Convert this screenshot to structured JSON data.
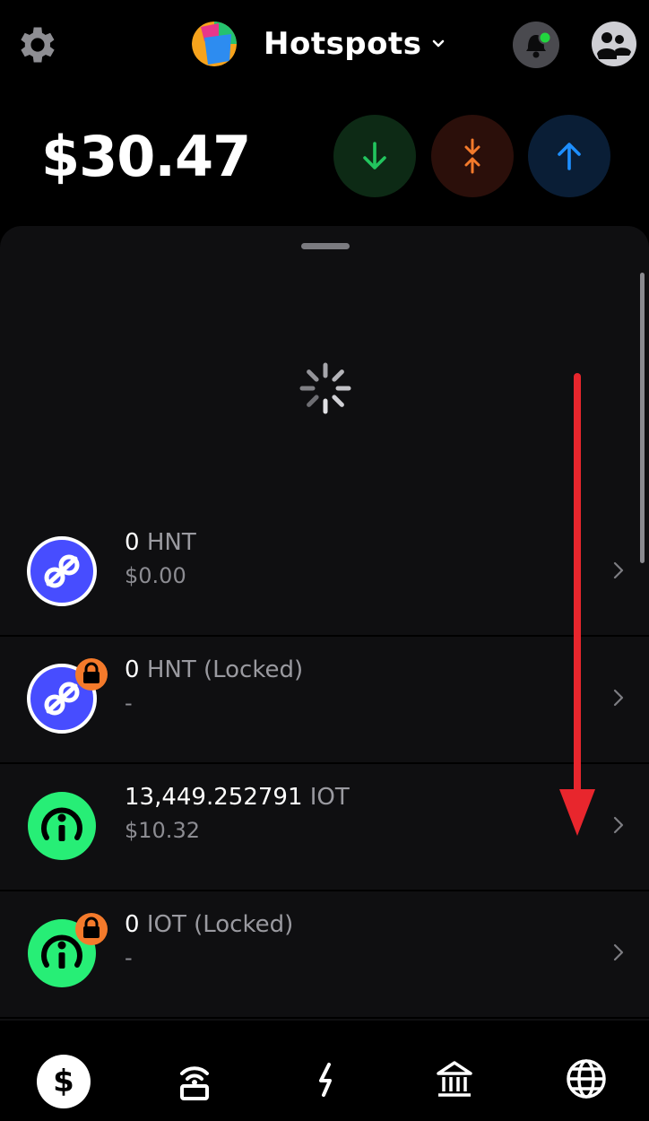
{
  "header": {
    "title": "Hotspots",
    "icons": [
      "gear-icon",
      "app-logo",
      "chevron-down-icon",
      "notification-bell-icon",
      "account-icon"
    ]
  },
  "balance": "$30.47",
  "actions": {
    "receive_icon": "arrow-down-icon",
    "swap_icon": "swap-icon",
    "send_icon": "arrow-up-icon",
    "colors": {
      "receive": "#22c55e",
      "swap": "#f47a2b",
      "send": "#1e8fff"
    }
  },
  "tokens": [
    {
      "amount": "0",
      "ticker": "HNT",
      "fiat": "$0.00",
      "icon": "helium-icon",
      "locked": false
    },
    {
      "amount": "0",
      "ticker": "HNT (Locked)",
      "fiat": "-",
      "icon": "helium-icon",
      "locked": true
    },
    {
      "amount": "13,449.252791",
      "ticker": "IOT",
      "fiat": "$10.32",
      "icon": "iot-icon",
      "locked": false
    },
    {
      "amount": "0",
      "ticker": "IOT (Locked)",
      "fiat": "-",
      "icon": "iot-icon",
      "locked": true
    }
  ],
  "colors": {
    "hnt": "#474dff",
    "iot": "#27ee76",
    "lock": "#f47a2b",
    "annotation_arrow": "#e8262d"
  },
  "tabbar": {
    "wallet_symbol": "$",
    "items": [
      "wallet-icon",
      "hotspot-icon",
      "activity-icon",
      "governance-icon",
      "browser-icon"
    ]
  }
}
